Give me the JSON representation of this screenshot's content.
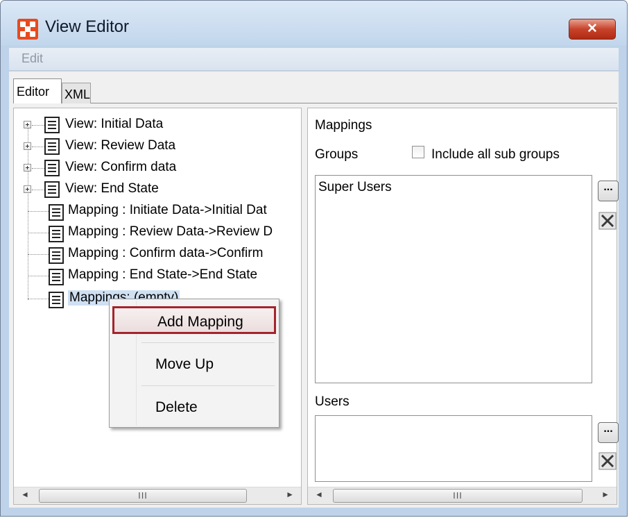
{
  "window": {
    "title": "View Editor",
    "close_glyph": "✕",
    "accent": "#c7432a"
  },
  "menu": {
    "items": [
      "Edit"
    ]
  },
  "tabs": [
    {
      "label": "Editor",
      "selected": true
    },
    {
      "label": "XML",
      "selected": false
    }
  ],
  "tree": {
    "items": [
      {
        "label": "View: Initial Data",
        "expandable": true,
        "icon": "document-icon"
      },
      {
        "label": "View: Review Data",
        "expandable": true,
        "icon": "document-icon"
      },
      {
        "label": "View: Confirm data",
        "expandable": true,
        "icon": "document-icon"
      },
      {
        "label": "View: End State",
        "expandable": true,
        "icon": "document-icon"
      },
      {
        "label": "Mapping : Initiate Data->Initial Dat",
        "expandable": false,
        "icon": "document-icon"
      },
      {
        "label": "Mapping : Review Data->Review D",
        "expandable": false,
        "icon": "document-icon"
      },
      {
        "label": "Mapping : Confirm data->Confirm",
        "expandable": false,
        "icon": "document-icon"
      },
      {
        "label": "Mapping : End State->End State",
        "expandable": false,
        "icon": "document-icon"
      },
      {
        "label": "Mappings: (empty)",
        "expandable": false,
        "icon": "document-icon",
        "selected": true
      }
    ]
  },
  "context_menu": {
    "items": [
      {
        "label": "Add Mapping",
        "highlighted": true
      },
      {
        "label": "Move Up",
        "highlighted": false
      },
      {
        "label": "Delete",
        "highlighted": false
      }
    ]
  },
  "scrollbar": {
    "grip": "III",
    "left_arrow": "◄",
    "right_arrow": "►"
  },
  "properties": {
    "mappings_label": "Mappings",
    "groups_label": "Groups",
    "include_sub_groups_label": "Include all sub groups",
    "include_sub_groups_checked": false,
    "groups_list": [
      "Super Users"
    ],
    "users_label": "Users",
    "users_list": [],
    "browse_button_label": "...",
    "remove_icon": "remove-x-icon"
  }
}
